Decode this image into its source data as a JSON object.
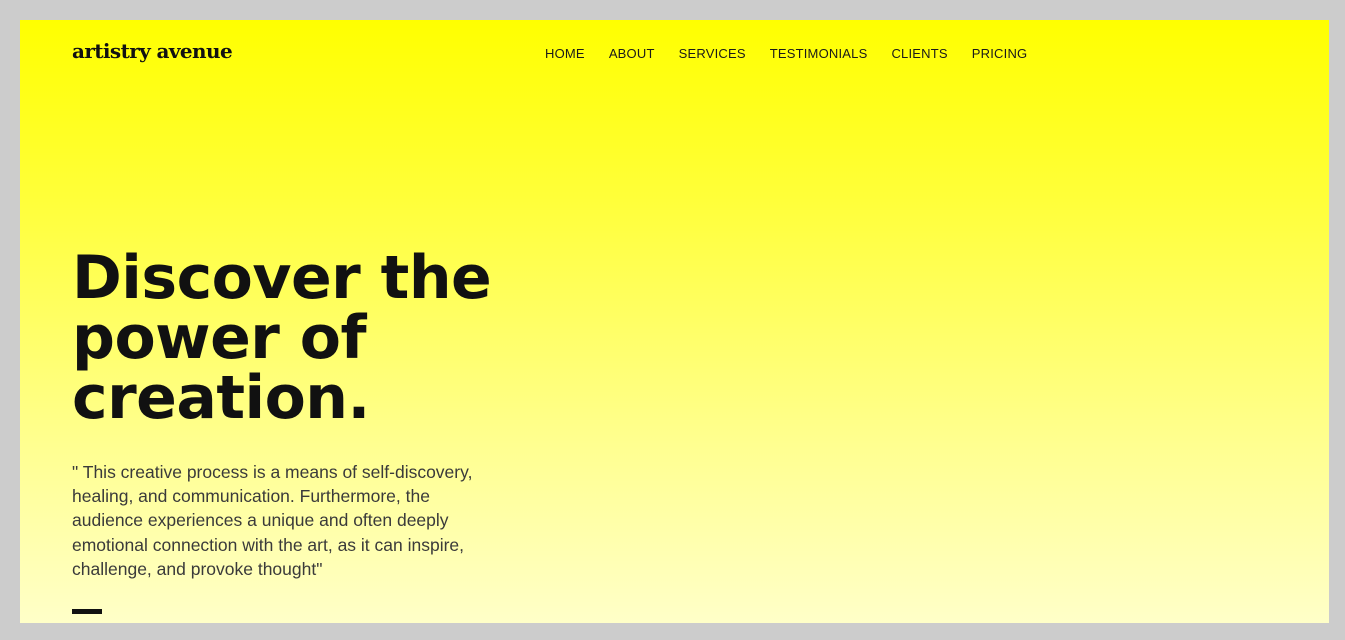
{
  "brand": {
    "logo_text": "artistry avenue"
  },
  "nav": {
    "items": [
      {
        "label": "HOME"
      },
      {
        "label": "ABOUT"
      },
      {
        "label": "SERVICES"
      },
      {
        "label": "TESTIMONIALS"
      },
      {
        "label": "CLIENTS"
      },
      {
        "label": "PRICING"
      }
    ]
  },
  "hero": {
    "headline_lines": [
      "Discover the",
      "power of",
      "creation."
    ],
    "quote_lines": [
      "\" This creative process is a means of self-discovery,",
      "healing, and communication. Furthermore, the",
      "audience experiences a unique and often deeply",
      "emotional connection with the art, as it can inspire,",
      "challenge, and provoke thought\""
    ]
  },
  "colors": {
    "background_top": "#ffff00",
    "background_bottom": "#ffffc8",
    "text_primary": "#111111",
    "outer_frame": "#cccccc"
  }
}
